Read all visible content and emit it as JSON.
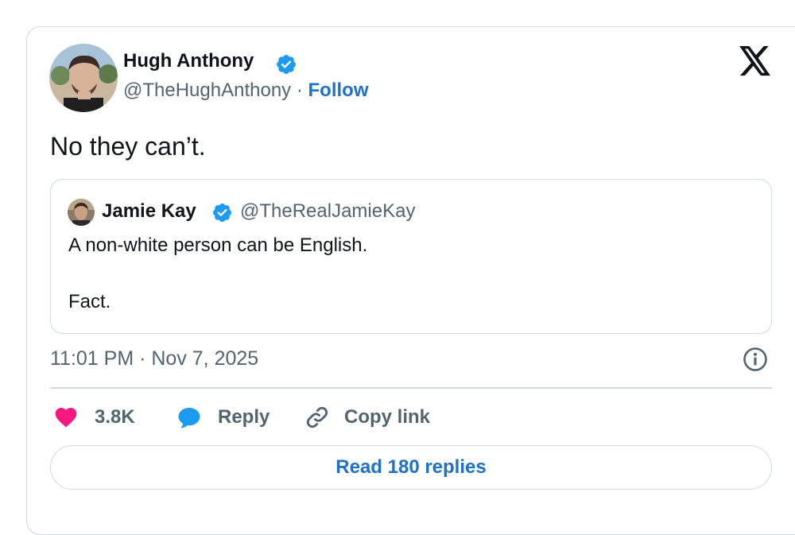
{
  "author": {
    "name": "Hugh Anthony",
    "handle": "@TheHughAnthony",
    "separator": "·",
    "follow_label": "Follow",
    "avatar": "profile-photo",
    "verified": true
  },
  "brand_icon": "x-logo-icon",
  "tweet": {
    "text": "No they can’t.",
    "timestamp": "11:01 PM · Nov 7, 2025"
  },
  "quote": {
    "name": "Jamie Kay",
    "handle": "@TheRealJamieKay",
    "verified": true,
    "lines": [
      "A non-white person can be English.",
      "Fact."
    ]
  },
  "actions": {
    "likes": "3.8K",
    "reply_label": "Reply",
    "copy_link_label": "Copy link"
  },
  "read_replies_label": "Read 180 replies",
  "colors": {
    "link": "#1d71c9",
    "verified_badge": "#1d9bf0",
    "like_heart": "#f91880",
    "reply_bubble": "#1d9bf0",
    "secondary_text": "#536471",
    "border": "#cfd9de"
  }
}
